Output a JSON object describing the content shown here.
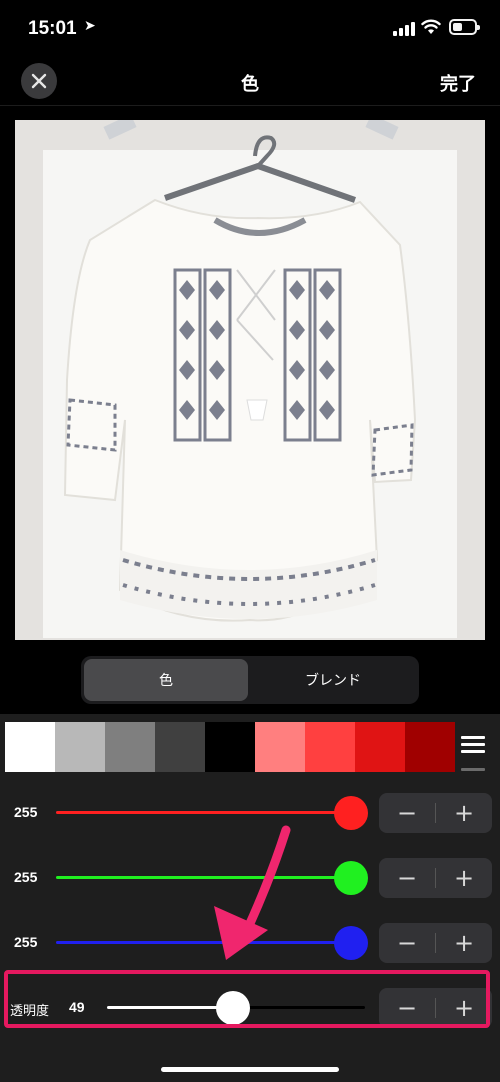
{
  "status": {
    "time": "15:01",
    "location_icon": "location-arrow-icon"
  },
  "nav": {
    "title": "色",
    "done": "完了",
    "close_icon": "close-icon"
  },
  "tabs": [
    {
      "label": "色",
      "active": true
    },
    {
      "label": "ブレンド",
      "active": false
    }
  ],
  "swatches": [
    "#ffffff",
    "#b8b8b8",
    "#7f7f7f",
    "#404040",
    "#000000",
    "#ff7f7f",
    "#ff4040",
    "#e01414",
    "#a00000"
  ],
  "sliders": [
    {
      "name": "red",
      "value": "255",
      "color": "#ff2020",
      "level": 1.0
    },
    {
      "name": "green",
      "value": "255",
      "color": "#20f020",
      "level": 1.0
    },
    {
      "name": "blue",
      "value": "255",
      "color": "#2020f0",
      "level": 1.0
    }
  ],
  "alpha": {
    "label": "透明度",
    "value": "49",
    "level": 0.49
  },
  "stepper": {
    "minus": "−",
    "plus": "+"
  },
  "colors": {
    "highlight": "#e5195f",
    "panel": "#1e1e1e"
  }
}
